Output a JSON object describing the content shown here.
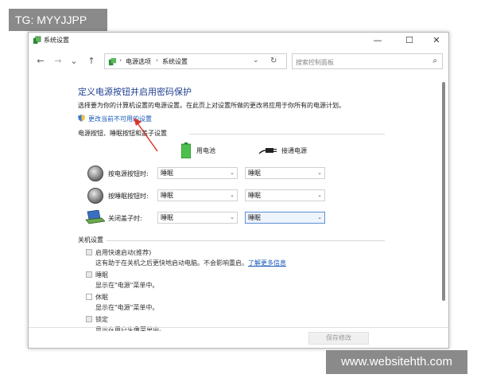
{
  "watermarks": {
    "top_left": "TG: MYYJJPP",
    "bottom_right": "www.websitehth.com"
  },
  "window": {
    "title": "系统设置",
    "minimize": "—",
    "maximize": "☐",
    "close": "✕"
  },
  "nav": {
    "back": "←",
    "forward": "→",
    "recent": "⌄",
    "up": "↑",
    "breadcrumb": [
      "电源选项",
      "系统设置"
    ],
    "search_placeholder": "搜索控制面板"
  },
  "content": {
    "heading": "定义电源按钮并启用密码保护",
    "description": "选择要为你的计算机设置的电源设置。在此页上对设置所做的更改将应用于你所有的电源计划。",
    "change_link": "更改当前不可用的设置",
    "power_group_label": "电源按钮、睡眠按钮和盖子设置",
    "col_battery": "用电池",
    "col_plugged": "接通电源",
    "rows": [
      {
        "label": "按电源按钮时:",
        "battery": "睡眠",
        "plugged": "睡眠"
      },
      {
        "label": "按睡眠按钮时:",
        "battery": "睡眠",
        "plugged": "睡眠"
      },
      {
        "label": "关闭盖子时:",
        "battery": "睡眠",
        "plugged": "睡眠"
      }
    ],
    "shutdown_group_label": "关机设置",
    "shutdown_items": [
      {
        "label": "启用快速启动(推荐)",
        "desc": "这有助于在关机之后更快地启动电脑。不会影响重启。",
        "more": "了解更多信息"
      },
      {
        "label": "睡眠",
        "desc": "显示在\"电源\"菜单中。"
      },
      {
        "label": "休眠",
        "desc": "显示在\"电源\"菜单中。"
      },
      {
        "label": "锁定",
        "desc": "显示在用户头像菜单中。"
      }
    ],
    "save_button": "保存修改"
  },
  "colors": {
    "heading": "#1f3f8f",
    "link": "#1a5ab8",
    "annotation_arrow": "#d9342b"
  }
}
